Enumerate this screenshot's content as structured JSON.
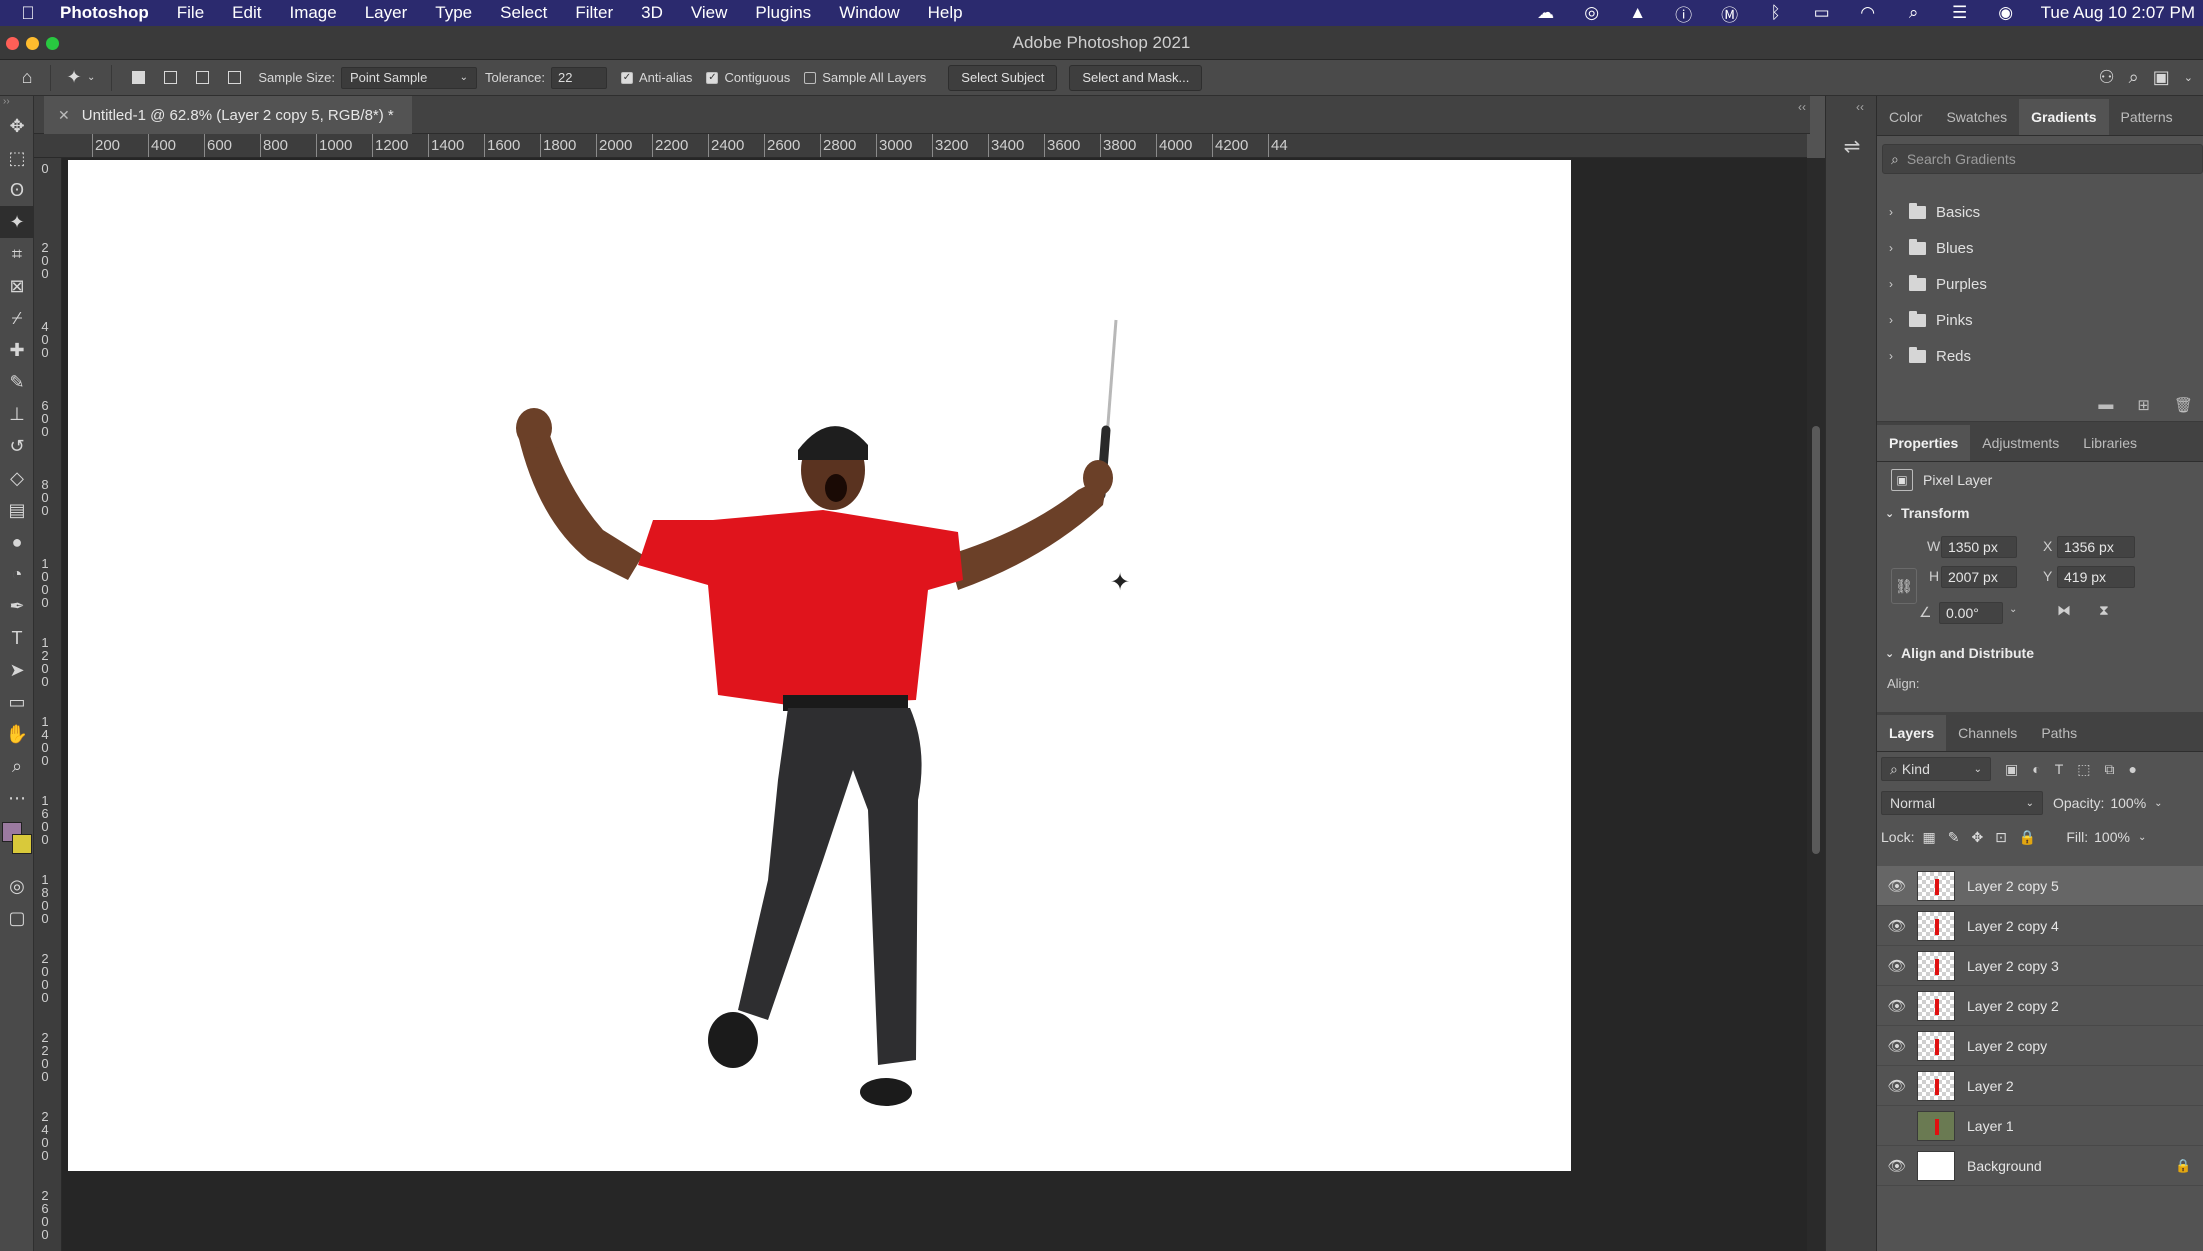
{
  "menubar": {
    "app_name": "Photoshop",
    "items": [
      "File",
      "Edit",
      "Image",
      "Layer",
      "Type",
      "Select",
      "Filter",
      "3D",
      "View",
      "Plugins",
      "Window",
      "Help"
    ],
    "clock": "Tue Aug 10  2:07 PM"
  },
  "window": {
    "title": "Adobe Photoshop 2021"
  },
  "options": {
    "sample_size_label": "Sample Size:",
    "sample_size_value": "Point Sample",
    "tolerance_label": "Tolerance:",
    "tolerance_value": "22",
    "anti_alias_label": "Anti-alias",
    "anti_alias_checked": true,
    "contiguous_label": "Contiguous",
    "contiguous_checked": true,
    "sample_all_label": "Sample All Layers",
    "sample_all_checked": false,
    "select_subject_label": "Select Subject",
    "select_mask_label": "Select and Mask..."
  },
  "document": {
    "tab_title": "Untitled-1 @ 62.8% (Layer 2 copy 5, RGB/8*) *",
    "ruler_h": [
      "200",
      "400",
      "600",
      "800",
      "1000",
      "1200",
      "1400",
      "1600",
      "1800",
      "2000",
      "2200",
      "2400",
      "2600",
      "2800",
      "3000",
      "3200",
      "3400",
      "3600",
      "3800",
      "4000",
      "4200",
      "44"
    ],
    "ruler_v": [
      "0",
      "200",
      "400",
      "600",
      "800",
      "1000",
      "1200",
      "1400",
      "1600",
      "1800",
      "2000",
      "2200",
      "2400",
      "2600"
    ]
  },
  "gradients_panel": {
    "tabs": [
      "Color",
      "Swatches",
      "Gradients",
      "Patterns"
    ],
    "active_tab": "Gradients",
    "search_placeholder": "Search Gradients",
    "folders": [
      "Basics",
      "Blues",
      "Purples",
      "Pinks",
      "Reds"
    ]
  },
  "properties_panel": {
    "tabs": [
      "Properties",
      "Adjustments",
      "Libraries"
    ],
    "active_tab": "Properties",
    "layer_type": "Pixel Layer",
    "transform_title": "Transform",
    "w_label": "W",
    "w_value": "1350 px",
    "h_label": "H",
    "h_value": "2007 px",
    "x_label": "X",
    "x_value": "1356 px",
    "y_label": "Y",
    "y_value": "419 px",
    "angle_value": "0.00°",
    "align_title": "Align and Distribute",
    "align_label": "Align:"
  },
  "layers_panel": {
    "tabs": [
      "Layers",
      "Channels",
      "Paths"
    ],
    "active_tab": "Layers",
    "filter_label": "Kind",
    "blend_mode": "Normal",
    "opacity_label": "Opacity:",
    "opacity_value": "100%",
    "lock_label": "Lock:",
    "fill_label": "Fill:",
    "fill_value": "100%",
    "layers": [
      {
        "name": "Layer 2 copy 5",
        "visible": true,
        "selected": true,
        "thumb": "cutout"
      },
      {
        "name": "Layer 2 copy 4",
        "visible": true,
        "selected": false,
        "thumb": "cutout"
      },
      {
        "name": "Layer 2 copy 3",
        "visible": true,
        "selected": false,
        "thumb": "cutout"
      },
      {
        "name": "Layer 2 copy 2",
        "visible": true,
        "selected": false,
        "thumb": "cutout"
      },
      {
        "name": "Layer 2 copy",
        "visible": true,
        "selected": false,
        "thumb": "cutout"
      },
      {
        "name": "Layer 2",
        "visible": true,
        "selected": false,
        "thumb": "cutout"
      },
      {
        "name": "Layer 1",
        "visible": false,
        "selected": false,
        "thumb": "photo"
      },
      {
        "name": "Background",
        "visible": true,
        "selected": false,
        "thumb": "white",
        "locked": true
      }
    ]
  },
  "colors": {
    "foreground": "#9b7aa0",
    "background": "#d9c93a",
    "menubar": "#2b2a6e",
    "shirt": "#e0141c"
  }
}
